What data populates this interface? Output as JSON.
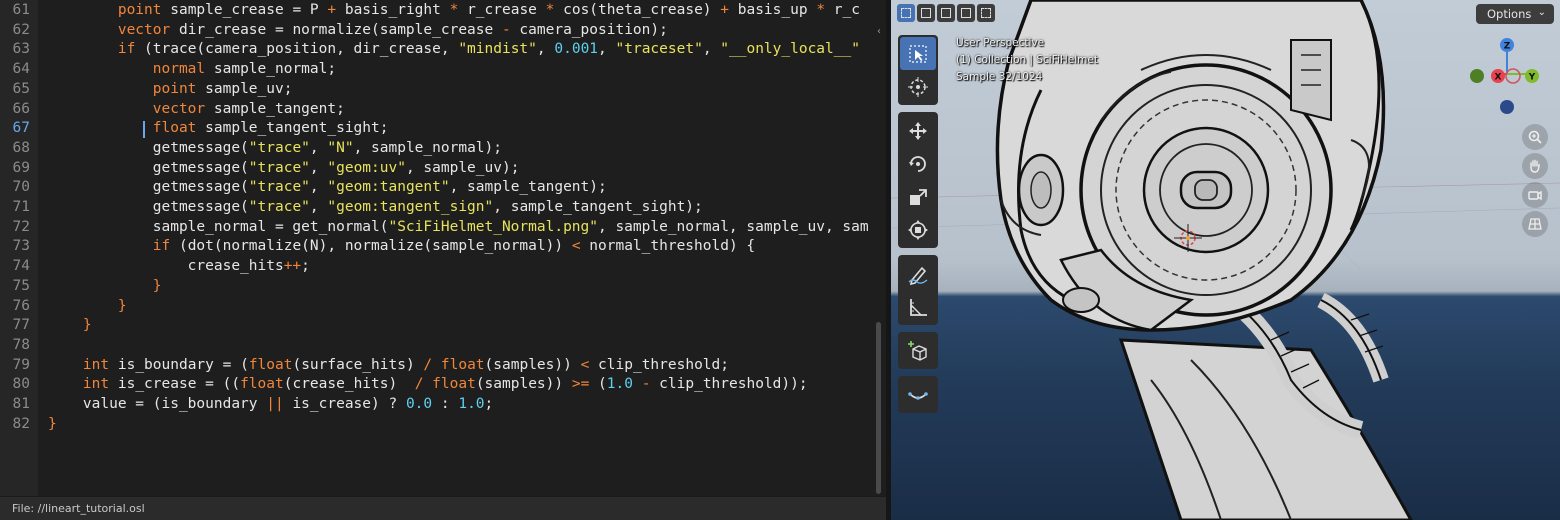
{
  "editor": {
    "file_label": "File: //lineart_tutorial.osl",
    "active_line": "67",
    "lines": [
      {
        "n": "61",
        "code": [
          [
            "        ",
            ""
          ],
          [
            "point",
            "kw"
          ],
          [
            " sample_crease = P ",
            ""
          ],
          [
            "+",
            "op"
          ],
          [
            " basis_right ",
            ""
          ],
          [
            "*",
            "op"
          ],
          [
            " r_crease ",
            ""
          ],
          [
            "*",
            "op"
          ],
          [
            " cos(theta_crease) ",
            ""
          ],
          [
            "+",
            "op"
          ],
          [
            " basis_up ",
            ""
          ],
          [
            "*",
            "op"
          ],
          [
            " r_c",
            ""
          ]
        ]
      },
      {
        "n": "62",
        "code": [
          [
            "        ",
            ""
          ],
          [
            "vector",
            "kw"
          ],
          [
            " dir_crease = normalize(sample_crease ",
            ""
          ],
          [
            "-",
            "op"
          ],
          [
            " camera_position);",
            ""
          ]
        ]
      },
      {
        "n": "63",
        "code": [
          [
            "        ",
            ""
          ],
          [
            "if",
            "kw"
          ],
          [
            " (trace(camera_position, dir_crease, ",
            ""
          ],
          [
            "\"mindist\"",
            "str"
          ],
          [
            ", ",
            ""
          ],
          [
            "0.001",
            "num"
          ],
          [
            ", ",
            ""
          ],
          [
            "\"traceset\"",
            "str"
          ],
          [
            ", ",
            ""
          ],
          [
            "\"__only_local__\"",
            "str"
          ]
        ]
      },
      {
        "n": "64",
        "code": [
          [
            "            ",
            ""
          ],
          [
            "normal",
            "kw"
          ],
          [
            " sample_normal;",
            ""
          ]
        ]
      },
      {
        "n": "65",
        "code": [
          [
            "            ",
            ""
          ],
          [
            "point",
            "kw"
          ],
          [
            " sample_uv;",
            ""
          ]
        ]
      },
      {
        "n": "66",
        "code": [
          [
            "            ",
            ""
          ],
          [
            "vector",
            "kw"
          ],
          [
            " sample_tangent;",
            ""
          ]
        ]
      },
      {
        "n": "67",
        "code": [
          [
            "            ",
            ""
          ],
          [
            "float",
            "kw"
          ],
          [
            " sample_tangent_sight;",
            ""
          ]
        ]
      },
      {
        "n": "68",
        "code": [
          [
            "            getmessage(",
            ""
          ],
          [
            "\"trace\"",
            "str"
          ],
          [
            ", ",
            ""
          ],
          [
            "\"N\"",
            "str"
          ],
          [
            ", sample_normal);",
            ""
          ]
        ]
      },
      {
        "n": "69",
        "code": [
          [
            "            getmessage(",
            ""
          ],
          [
            "\"trace\"",
            "str"
          ],
          [
            ", ",
            ""
          ],
          [
            "\"geom:uv\"",
            "str"
          ],
          [
            ", sample_uv);",
            ""
          ]
        ]
      },
      {
        "n": "70",
        "code": [
          [
            "            getmessage(",
            ""
          ],
          [
            "\"trace\"",
            "str"
          ],
          [
            ", ",
            ""
          ],
          [
            "\"geom:tangent\"",
            "str"
          ],
          [
            ", sample_tangent);",
            ""
          ]
        ]
      },
      {
        "n": "71",
        "code": [
          [
            "            getmessage(",
            ""
          ],
          [
            "\"trace\"",
            "str"
          ],
          [
            ", ",
            ""
          ],
          [
            "\"geom:tangent_sign\"",
            "str"
          ],
          [
            ", sample_tangent_sight);",
            ""
          ]
        ]
      },
      {
        "n": "72",
        "code": [
          [
            "            sample_normal = get_normal(",
            ""
          ],
          [
            "\"SciFiHelmet_Normal.png\"",
            "str"
          ],
          [
            ", sample_normal, sample_uv, sam",
            ""
          ]
        ]
      },
      {
        "n": "73",
        "code": [
          [
            "            ",
            ""
          ],
          [
            "if",
            "kw"
          ],
          [
            " (dot(normalize(N), normalize(sample_normal)) ",
            ""
          ],
          [
            "<",
            "op"
          ],
          [
            " normal_threshold) {",
            ""
          ]
        ]
      },
      {
        "n": "74",
        "code": [
          [
            "                crease_hits",
            ""
          ],
          [
            "++",
            "op"
          ],
          [
            ";",
            ""
          ]
        ]
      },
      {
        "n": "75",
        "code": [
          [
            "            }",
            "op"
          ]
        ]
      },
      {
        "n": "76",
        "code": [
          [
            "        }",
            "op"
          ]
        ]
      },
      {
        "n": "77",
        "code": [
          [
            "    }",
            "op"
          ]
        ]
      },
      {
        "n": "78",
        "code": []
      },
      {
        "n": "79",
        "code": [
          [
            "    ",
            ""
          ],
          [
            "int",
            "kw"
          ],
          [
            " is_boundary = (",
            ""
          ],
          [
            "float",
            "kw"
          ],
          [
            "(surface_hits) ",
            ""
          ],
          [
            "/",
            "op"
          ],
          [
            " ",
            ""
          ],
          [
            "float",
            "kw"
          ],
          [
            "(samples)) ",
            ""
          ],
          [
            "<",
            "op"
          ],
          [
            " clip_threshold;",
            ""
          ]
        ]
      },
      {
        "n": "80",
        "code": [
          [
            "    ",
            ""
          ],
          [
            "int",
            "kw"
          ],
          [
            " is_crease = ((",
            ""
          ],
          [
            "float",
            "kw"
          ],
          [
            "(crease_hits)  ",
            ""
          ],
          [
            "/",
            "op"
          ],
          [
            " ",
            ""
          ],
          [
            "float",
            "kw"
          ],
          [
            "(samples)) ",
            ""
          ],
          [
            ">=",
            "op"
          ],
          [
            " (",
            ""
          ],
          [
            "1.0",
            "num"
          ],
          [
            " ",
            ""
          ],
          [
            "-",
            "op"
          ],
          [
            " clip_threshold));",
            ""
          ]
        ]
      },
      {
        "n": "81",
        "code": [
          [
            "    value = (is_boundary ",
            ""
          ],
          [
            "||",
            "op"
          ],
          [
            " is_crease) ? ",
            ""
          ],
          [
            "0.0",
            "num"
          ],
          [
            " : ",
            ""
          ],
          [
            "1.0",
            "num"
          ],
          [
            ";",
            ""
          ]
        ]
      },
      {
        "n": "82",
        "code": [
          [
            "}",
            "op"
          ]
        ]
      }
    ]
  },
  "viewport": {
    "options_label": "Options",
    "overlay": {
      "view_name": "User Perspective",
      "collection": "(1) Collection | SciFiHelmet",
      "sample": "Sample 32/1024"
    },
    "axes": {
      "x": "X",
      "y": "Y",
      "z": "Z"
    },
    "colors": {
      "x_axis": "#e8424f",
      "y_axis": "#7fbb2c",
      "z_axis": "#3f83de",
      "active_tool": "#4772b3"
    },
    "tools": [
      "select-box-icon",
      "cursor-icon",
      "move-icon",
      "rotate-icon",
      "scale-icon",
      "transform-icon",
      "annotate-icon",
      "measure-icon",
      "add-cube-icon",
      "shear-icon"
    ]
  }
}
